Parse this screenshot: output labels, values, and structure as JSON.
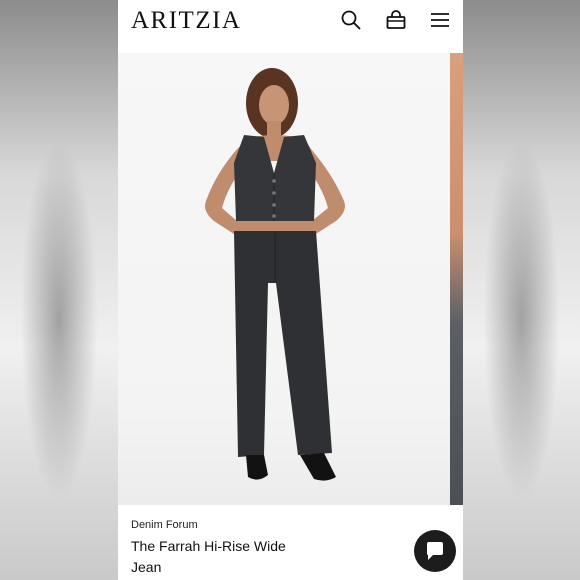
{
  "header": {
    "logo": "ARITZIA",
    "icons": [
      "search-icon",
      "bag-icon",
      "menu-icon"
    ]
  },
  "product": {
    "brand": "Denim Forum",
    "name": "The Farrah Hi-Rise Wide Jean"
  },
  "chat": {
    "icon": "chat-icon"
  },
  "colors": {
    "text": "#111111",
    "chat_button": "#1c1c1c",
    "denim": "#2e3034"
  }
}
